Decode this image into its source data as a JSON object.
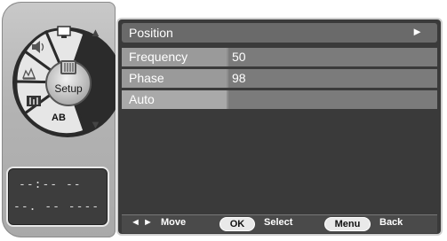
{
  "sidebar": {
    "setup_label": "Setup",
    "ab_label": "AB",
    "clock_time": "--:-- --",
    "clock_date": "--. -- ----",
    "icons": [
      "monitor-icon",
      "speaker-icon",
      "picture-icon",
      "equalizer-icon",
      "setup-icon",
      "ab-icon"
    ]
  },
  "menu": {
    "title": "Position",
    "title_arrow": "►",
    "rows": [
      {
        "label": "Frequency",
        "value": "50"
      },
      {
        "label": "Phase",
        "value": "98"
      },
      {
        "label": "Auto",
        "value": ""
      }
    ]
  },
  "footer": {
    "arrows": "◄ ►",
    "move": "Move",
    "ok": "OK",
    "select": "Select",
    "menu": "Menu",
    "back": "Back"
  },
  "colors": {
    "panel_bg": "#3a3a3a",
    "header_bg": "#6a6a6a",
    "row_label_bg": "#9a9a9a",
    "row_value_bg": "#7b7b7b"
  }
}
